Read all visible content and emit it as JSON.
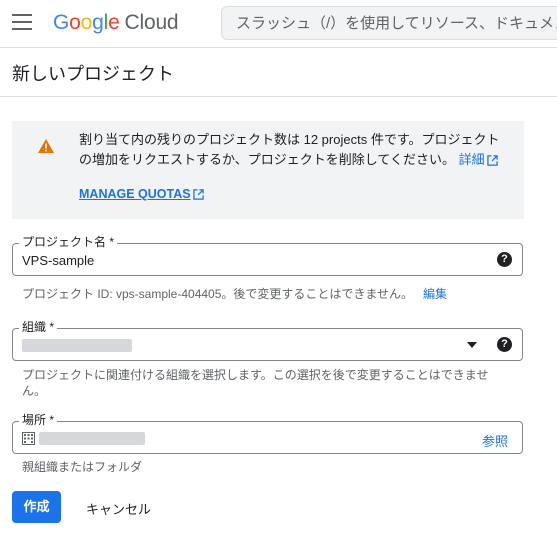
{
  "header": {
    "logo_google": [
      "G",
      "o",
      "o",
      "g",
      "l",
      "e"
    ],
    "logo_cloud": "Cloud",
    "search_placeholder": "スラッシュ（/）を使用してリソース、ドキュメント"
  },
  "page": {
    "title": "新しいプロジェクト"
  },
  "quota": {
    "message": "割り当て内の残りのプロジェクト数は 12 projects 件です。プロジェクトの増加をリクエストするか、プロジェクトを削除してください。",
    "details_link": "詳細",
    "manage_link": "MANAGE QUOTAS"
  },
  "form": {
    "project_name": {
      "label": "プロジェクト名 *",
      "value": "VPS-sample",
      "hint": "プロジェクト ID: vps-sample-404405。後で変更することはできません。",
      "edit_link": "編集"
    },
    "organization": {
      "label": "組織 *",
      "hint_line1": "プロジェクトに関連付ける組織を選択します。この選択を後で変更することはできませ",
      "hint_line2": "ん。"
    },
    "location": {
      "label": "場所 *",
      "browse_link": "参照",
      "hint": "親組織またはフォルダ"
    }
  },
  "actions": {
    "create": "作成",
    "cancel": "キャンセル"
  },
  "colors": {
    "accent": "#1a73e8",
    "warning": "#e37400"
  }
}
